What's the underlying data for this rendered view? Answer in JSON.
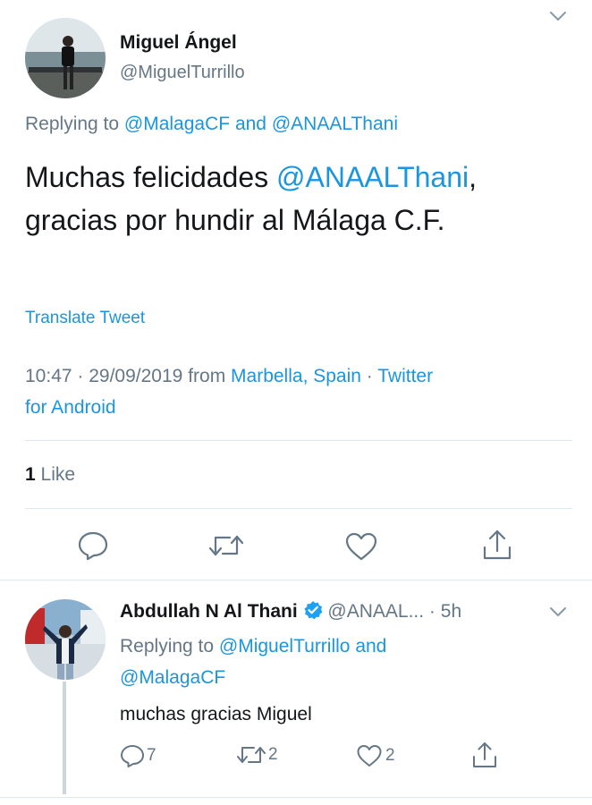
{
  "main_tweet": {
    "author_name": "Miguel Ángel",
    "author_handle": "@MiguelTurrillo",
    "replying_prefix": "Replying to",
    "replying_to_1": "@MalagaCF",
    "replying_and": "and",
    "replying_to_2": "@ANAALThani",
    "text_part1": "Muchas felicidades ",
    "text_mention": "@ANAALThani",
    "text_part2": ",",
    "text_line2": "gracias por hundir al Málaga C.F.",
    "translate_label": "Translate Tweet",
    "time": "10:47",
    "date": "29/09/2019",
    "from_label": "from",
    "location": "Marbella, Spain",
    "source_line1": "Twitter",
    "source_line2": "for Android",
    "like_count": "1",
    "like_label": "Like"
  },
  "reply_tweet": {
    "author_name": "Abdullah N Al Thani",
    "author_handle": "@ANAAL...",
    "time_ago": "5h",
    "replying_prefix": "Replying to",
    "replying_to_1": "@MiguelTurrillo",
    "replying_and": "and",
    "replying_to_2": "@MalagaCF",
    "text": "muchas gracias Miguel",
    "reply_count": "7",
    "retweet_count": "2",
    "like_count": "2"
  },
  "icons": [
    "chevron-down-icon",
    "reply-icon",
    "retweet-icon",
    "like-icon",
    "share-icon",
    "verified-badge-icon"
  ],
  "colors": {
    "link": "#1b95e0",
    "secondary": "#657786",
    "icon": "#657786",
    "divider": "#e1e8ed"
  }
}
